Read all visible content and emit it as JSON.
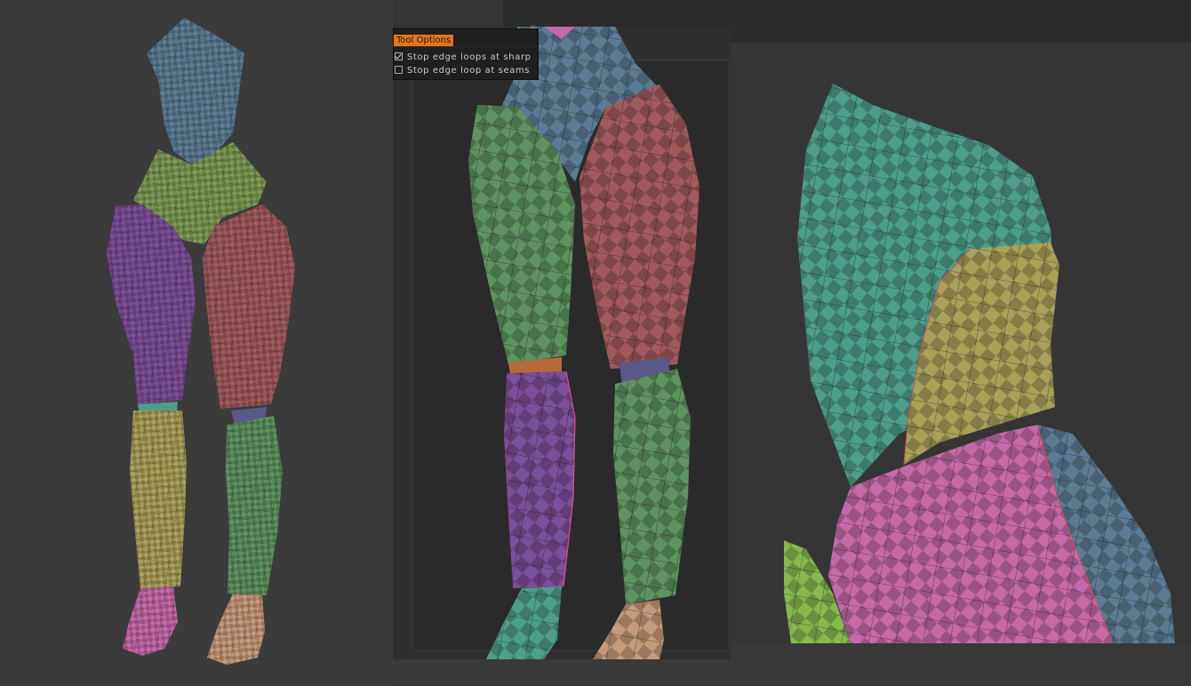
{
  "tool_options": {
    "title": "Tool Options",
    "options": [
      {
        "label": "Stop edge loops at sharp",
        "checked": true
      },
      {
        "label": "Stop edge loop at seams",
        "checked": false
      }
    ]
  },
  "colors": {
    "torso_blue": "#5b7c94",
    "hips_olive": "#7f9a55",
    "thigh_purple": "#7d4e99",
    "thigh_red": "#a05a5e",
    "shin_yellow": "#a9a05a",
    "shin_green": "#5e9460",
    "foot_pink": "#c56aa9",
    "foot_tan": "#c69a7a",
    "teal": "#4e9e8a",
    "orange_accent": "#e8741a"
  },
  "icons": [
    "close-icon",
    "checkbox-checked-icon",
    "checkbox-empty-icon"
  ]
}
